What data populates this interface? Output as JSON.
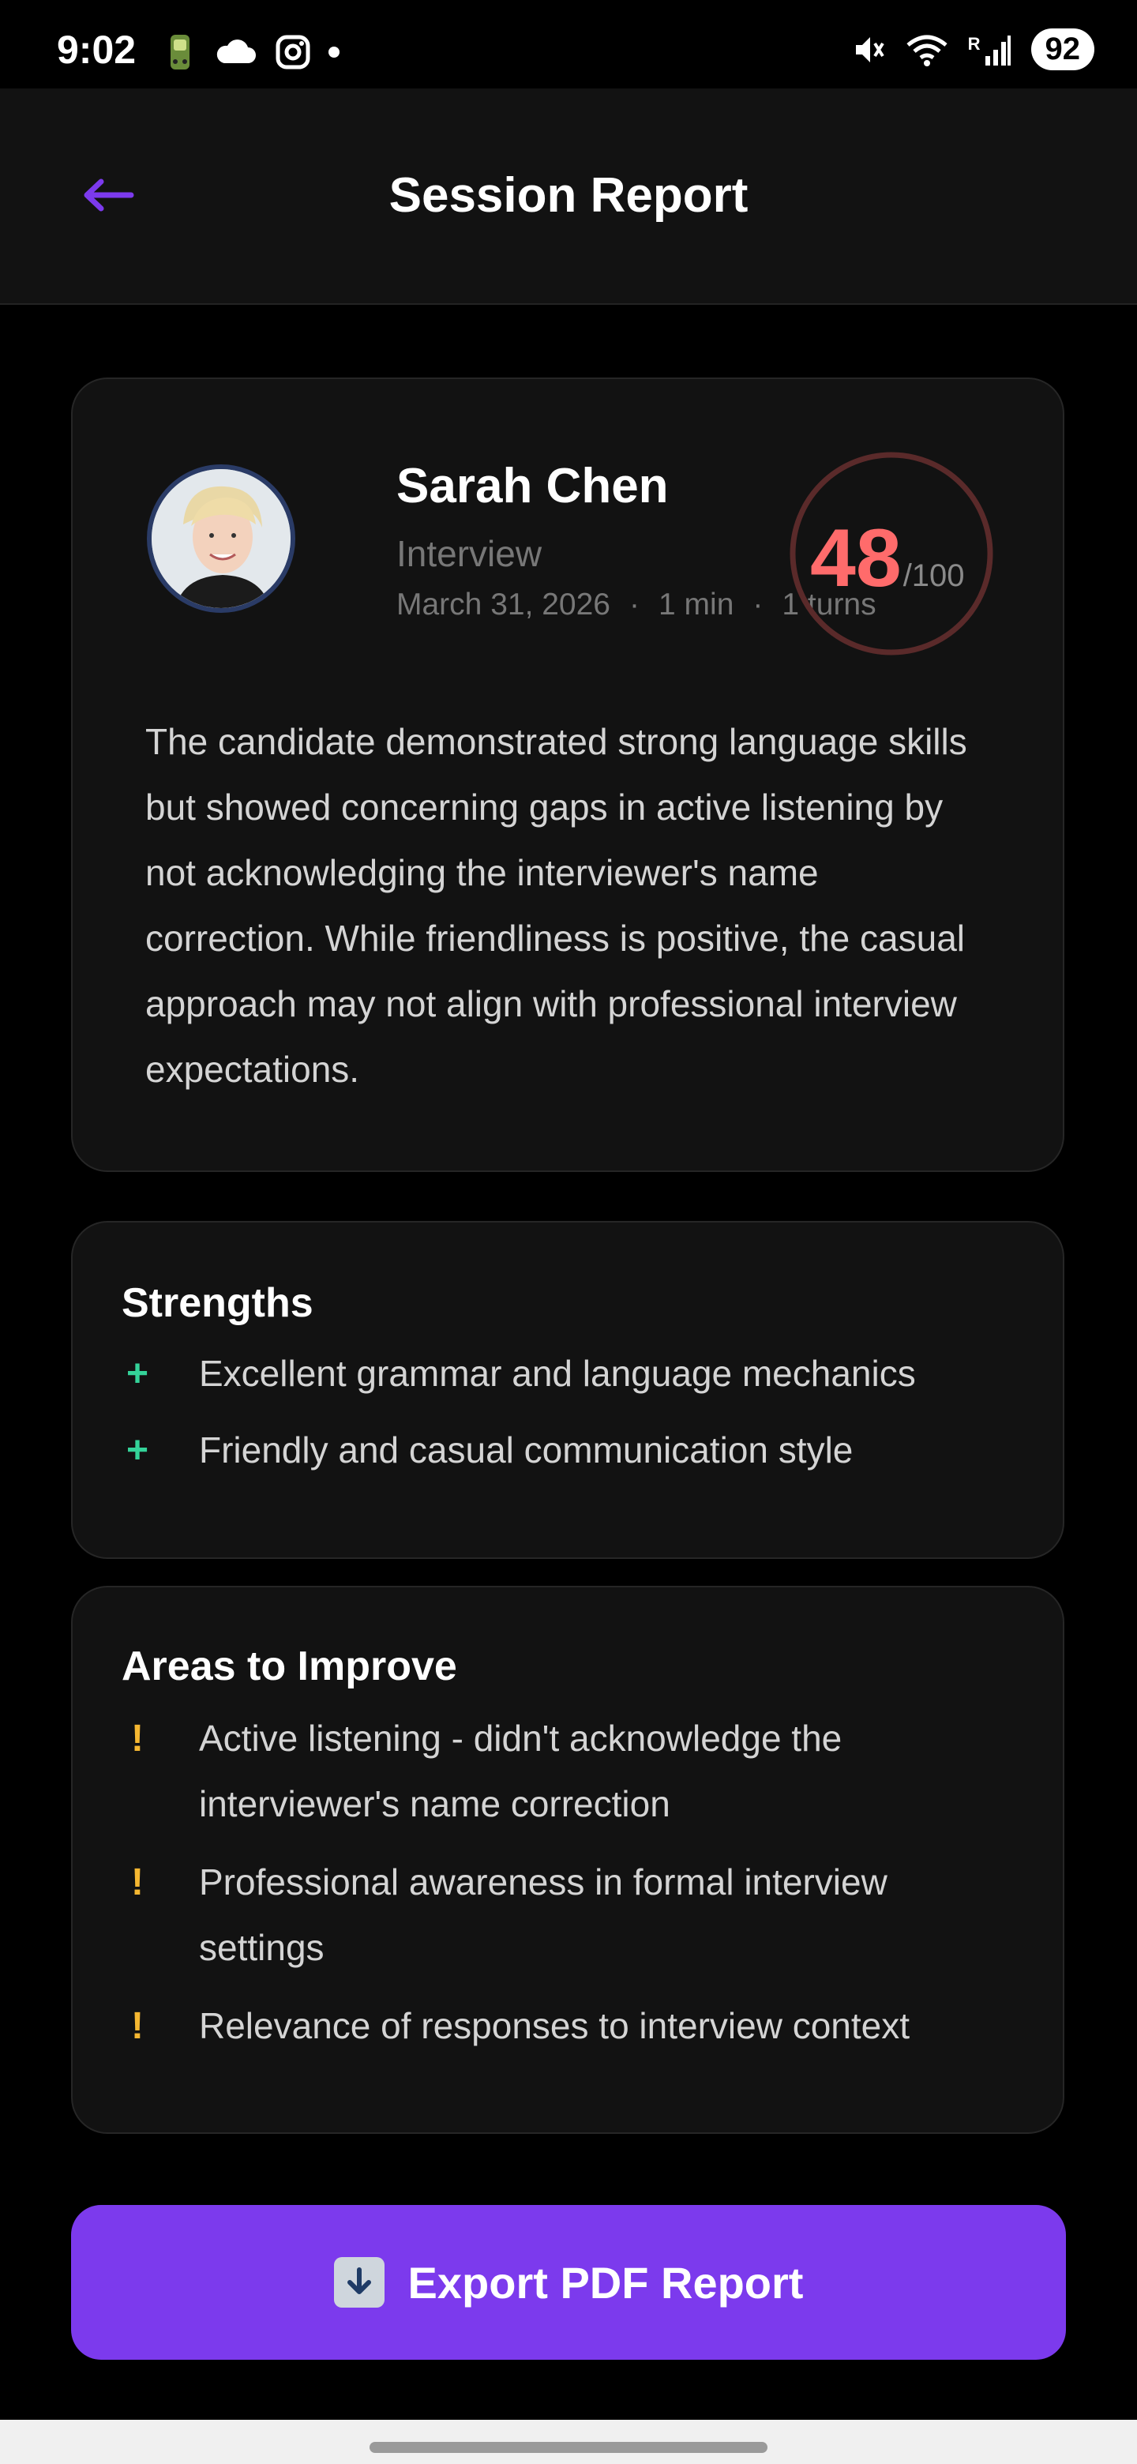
{
  "status_bar": {
    "time": "9:02",
    "left_icons": [
      "car-app-icon",
      "cloud-icon",
      "instagram-icon",
      "dot-icon"
    ],
    "right_icons": [
      "mute-icon",
      "wifi-icon",
      "signal-icon"
    ],
    "signal_label": "R",
    "battery": "92"
  },
  "header": {
    "title": "Session Report",
    "back_icon": "arrow-left-icon",
    "accent_color": "#7c3aed"
  },
  "profile": {
    "name": "Sarah Chen",
    "session_type": "Interview",
    "date": "March 31, 2026",
    "duration": "1 min",
    "turns": "1 turns",
    "separator": "·",
    "score": "48",
    "score_max": "/100",
    "score_value": 48,
    "score_color": "#ff6b6b",
    "summary": "The candidate demonstrated strong language skills but showed concerning gaps in active listening by not acknowledging the interviewer's name correction. While friendliness is positive, the casual approach may not align with professional interview expectations."
  },
  "strengths": {
    "title": "Strengths",
    "marker": "+",
    "items": [
      "Excellent grammar and language mechanics",
      "Friendly and casual communication style"
    ]
  },
  "improve": {
    "title": "Areas to Improve",
    "marker": "!",
    "items": [
      "Active listening - didn't acknowledge the interviewer's name correction",
      "Professional awareness in formal interview settings",
      "Relevance of responses to interview context"
    ]
  },
  "export": {
    "label": "Export PDF Report",
    "icon": "download-arrow-icon"
  }
}
